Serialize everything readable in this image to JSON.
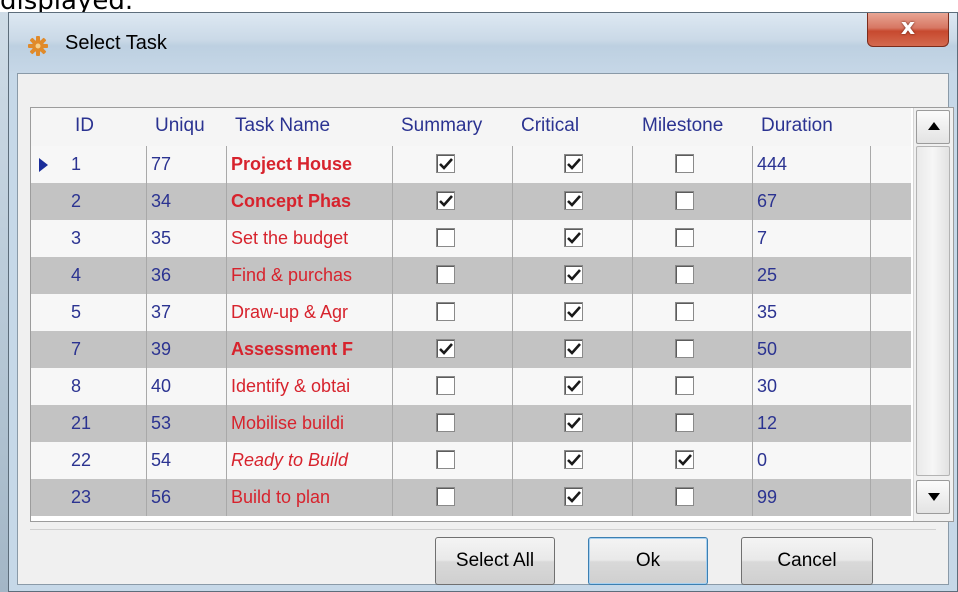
{
  "caption": "displayed.",
  "window": {
    "title": "Select Task",
    "close_label": "x"
  },
  "grid": {
    "columns": [
      "ID",
      "Uniqu",
      "Task Name",
      "Summary",
      "Critical",
      "Milestone",
      "Duration"
    ],
    "rows": [
      {
        "id": "1",
        "unique": "77",
        "name": "Project House",
        "summary": true,
        "critical": true,
        "milestone": false,
        "duration": "444",
        "style": "bold",
        "current": true
      },
      {
        "id": "2",
        "unique": "34",
        "name": "Concept Phas",
        "summary": true,
        "critical": true,
        "milestone": false,
        "duration": "67",
        "style": "bold",
        "current": false
      },
      {
        "id": "3",
        "unique": "35",
        "name": "Set the budget",
        "summary": false,
        "critical": true,
        "milestone": false,
        "duration": "7",
        "style": "normal",
        "current": false
      },
      {
        "id": "4",
        "unique": "36",
        "name": "Find & purchas",
        "summary": false,
        "critical": true,
        "milestone": false,
        "duration": "25",
        "style": "normal",
        "current": false
      },
      {
        "id": "5",
        "unique": "37",
        "name": "Draw-up & Agr",
        "summary": false,
        "critical": true,
        "milestone": false,
        "duration": "35",
        "style": "normal",
        "current": false
      },
      {
        "id": "7",
        "unique": "39",
        "name": "Assessment F",
        "summary": true,
        "critical": true,
        "milestone": false,
        "duration": "50",
        "style": "bold",
        "current": false
      },
      {
        "id": "8",
        "unique": "40",
        "name": "Identify & obtai",
        "summary": false,
        "critical": true,
        "milestone": false,
        "duration": "30",
        "style": "normal",
        "current": false
      },
      {
        "id": "21",
        "unique": "53",
        "name": "Mobilise buildi",
        "summary": false,
        "critical": true,
        "milestone": false,
        "duration": "12",
        "style": "normal",
        "current": false
      },
      {
        "id": "22",
        "unique": "54",
        "name": "Ready to Build",
        "summary": false,
        "critical": true,
        "milestone": true,
        "duration": "0",
        "style": "italic",
        "current": false
      },
      {
        "id": "23",
        "unique": "56",
        "name": "Build to plan",
        "summary": false,
        "critical": true,
        "milestone": false,
        "duration": "99",
        "style": "normal",
        "current": false
      }
    ]
  },
  "buttons": {
    "select_all": "Select All",
    "ok": "Ok",
    "cancel": "Cancel"
  },
  "icons": {
    "app": "gear-icon",
    "close": "close-icon",
    "row_indicator": "current-row-arrow-icon",
    "scroll_up": "arrow-up-icon",
    "scroll_down": "arrow-down-icon"
  }
}
